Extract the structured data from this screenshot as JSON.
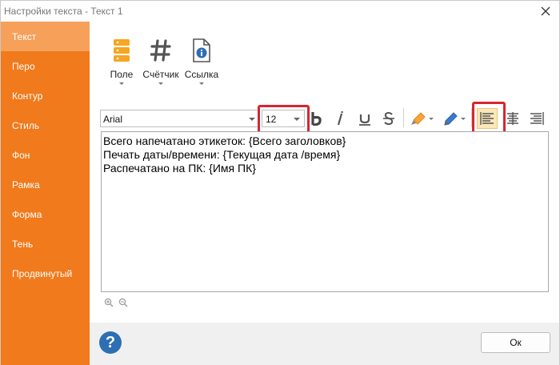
{
  "window": {
    "title": "Настройки текста - Текст 1"
  },
  "sidebar": {
    "items": [
      {
        "label": "Текст",
        "active": true
      },
      {
        "label": "Перо"
      },
      {
        "label": "Контур"
      },
      {
        "label": "Стиль"
      },
      {
        "label": "Фон"
      },
      {
        "label": "Рамка"
      },
      {
        "label": "Форма"
      },
      {
        "label": "Тень"
      },
      {
        "label": "Продвинутый"
      }
    ]
  },
  "ribbon": {
    "field_label": "Поле",
    "counter_label": "Счётчик",
    "link_label": "Ссылка"
  },
  "toolbar": {
    "font_family": "Arial",
    "font_size": "12"
  },
  "editor": {
    "lines": [
      "Всего напечатано этикеток: {Всего заголовков}",
      "Печать даты/времени: {Текущая дата /время}",
      "Распечатано на ПК: {Имя ПК}"
    ]
  },
  "footer": {
    "help_symbol": "?",
    "ok_label": "Ок"
  },
  "colors": {
    "sidebar_bg": "#f07a1c",
    "sidebar_active": "#f6a05a",
    "highlight": "#d7262f",
    "accent_blue": "#2d6fb3"
  }
}
